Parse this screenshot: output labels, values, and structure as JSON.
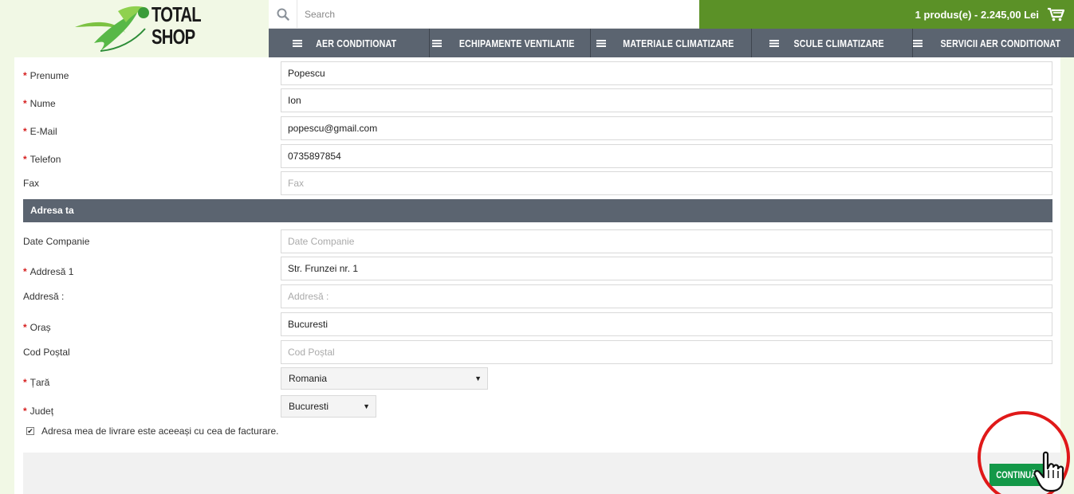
{
  "header": {
    "logo_line1": "TOTAL",
    "logo_line2": "SHOP",
    "search_placeholder": "Search",
    "cart_text": "1 produs(e) - 2.245,00 Lei",
    "nav": [
      {
        "label": "AER CONDITIONAT"
      },
      {
        "label": "ECHIPAMENTE VENTILATIE"
      },
      {
        "label": "MATERIALE CLIMATIZARE"
      },
      {
        "label": "SCULE CLIMATIZARE"
      },
      {
        "label": "SERVICII AER CONDITIONAT"
      }
    ]
  },
  "form": {
    "required_mark": "*",
    "prenume": {
      "label": "Prenume",
      "value": "Popescu"
    },
    "nume": {
      "label": "Nume",
      "value": "Ion"
    },
    "email": {
      "label": "E-Mail",
      "value": "popescu@gmail.com"
    },
    "telefon": {
      "label": "Telefon",
      "value": "0735897854"
    },
    "fax": {
      "label": "Fax",
      "value": "",
      "placeholder": "Fax"
    },
    "section_title": "Adresa ta",
    "companie": {
      "label": "Date Companie",
      "value": "",
      "placeholder": "Date Companie"
    },
    "adresa1": {
      "label": "Addresă 1",
      "value": "Str. Frunzei nr. 1"
    },
    "adresa2": {
      "label": "Addresă :",
      "value": "",
      "placeholder": "Addresă :"
    },
    "oras": {
      "label": "Oraș",
      "value": "Bucuresti"
    },
    "cod_postal": {
      "label": "Cod Poștal",
      "value": "",
      "placeholder": "Cod Poștal"
    },
    "tara": {
      "label": "Țară",
      "selected": "Romania"
    },
    "judet": {
      "label": "Județ",
      "selected": "Bucuresti"
    },
    "same_address_label": "Adresa mea de livrare este aceeași cu cea de facturare.",
    "same_address_checked": true,
    "continue_label": "CONTINUĂ"
  },
  "colors": {
    "brand_green": "#5b9127",
    "nav_gray": "#5b6470",
    "button_green": "#139848",
    "highlight_red": "#e01919"
  }
}
